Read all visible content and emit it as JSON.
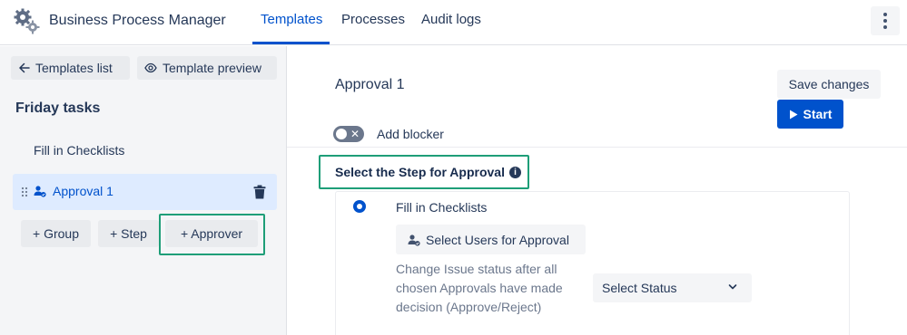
{
  "header": {
    "app_title": "Business Process Manager",
    "tabs": [
      {
        "label": "Templates",
        "active": true
      },
      {
        "label": "Processes",
        "active": false
      },
      {
        "label": "Audit logs",
        "active": false
      }
    ],
    "logo_icon": "gears-icon",
    "more_icon": "more-vertical-icon"
  },
  "sidebar": {
    "templates_list_label": "Templates list",
    "template_preview_label": "Template preview",
    "template_name": "Friday tasks",
    "steps": [
      {
        "label": "Fill in Checklists",
        "selected": false
      },
      {
        "label": "Approval 1",
        "selected": true
      }
    ],
    "add_group_label": "+ Group",
    "add_step_label": "+ Step",
    "add_approver_label": "+ Approver"
  },
  "main": {
    "title": "Approval 1",
    "save_label": "Save changes",
    "start_label": "Start",
    "blocker_label": "Add blocker",
    "blocker_enabled": false,
    "step_heading": "Select the Step for Approval",
    "info_glyph": "i",
    "card": {
      "step_option": "Fill in Checklists",
      "select_users_label": "Select Users for Approval",
      "status_description": "Change Issue status after all chosen Approvals have made decision (Approve/Reject)",
      "status_select_value": "Select Status"
    }
  },
  "colors": {
    "accent": "#0052cc",
    "highlight": "#1e9e78",
    "selected_bg": "#deebff"
  }
}
